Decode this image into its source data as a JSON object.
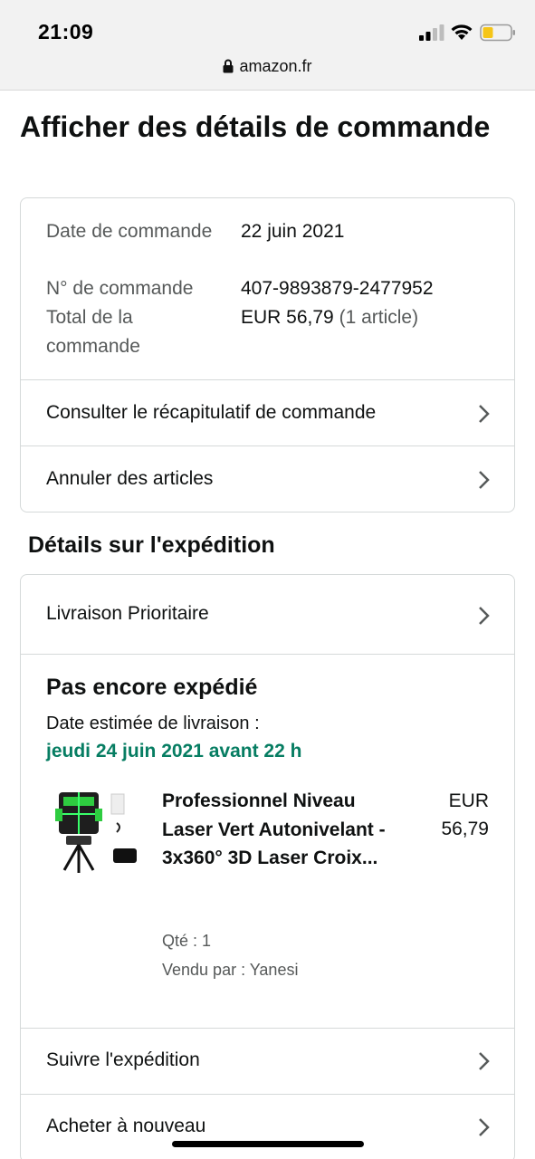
{
  "status_bar": {
    "time": "21:09",
    "url": "amazon.fr"
  },
  "page_title": "Afficher des détails de commande",
  "order_info": {
    "date_label": "Date de commande",
    "date_value": "22 juin 2021",
    "number_label": "N° de commande",
    "number_value": "407-9893879-2477952",
    "total_label": "Total de la commande",
    "total_value": "EUR 56,79",
    "total_items": "(1 article)"
  },
  "order_links": {
    "summary": "Consulter le récapitulatif de commande",
    "cancel": "Annuler des articles"
  },
  "shipping": {
    "section_title": "Détails sur l'expédition",
    "method": "Livraison Prioritaire",
    "status": "Pas encore expédié",
    "eta_label": "Date estimée de livraison :",
    "eta_date": "jeudi 24 juin 2021 avant 22 h",
    "track_link": "Suivre l'expédition",
    "buy_again_link": "Acheter à nouveau"
  },
  "product": {
    "title": "Professionnel Niveau Laser Vert Autonivelant - 3x360° 3D Laser Croix...",
    "price_currency": "EUR",
    "price_value": "56,79",
    "quantity": "Qté : 1",
    "seller": "Vendu par : Yanesi"
  },
  "colors": {
    "eta_green": "#067d62",
    "border": "#d5d9d9",
    "muted_text": "#565959"
  },
  "icons": [
    "lock-icon",
    "signal-icon",
    "wifi-icon",
    "battery-icon",
    "chevron-right-icon"
  ]
}
